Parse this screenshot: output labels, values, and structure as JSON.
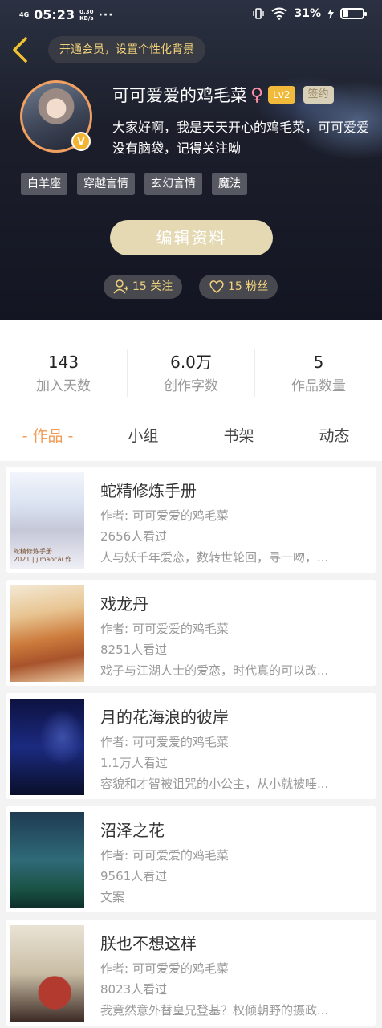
{
  "status_bar": {
    "network": "4G",
    "time": "05:23",
    "speed_value": "0.30",
    "speed_unit": "KB/s",
    "more": "···",
    "battery_pct": "31%",
    "battery_level": 0.31
  },
  "header": {
    "vip_prompt": "开通会员，设置个性化背景",
    "username": "可可爱爱的鸡毛菜",
    "gender_symbol": "♀",
    "level": "Lv2",
    "sign_badge": "签约",
    "bio": "大家好啊，我是天天开心的鸡毛菜，可可爱爱没有脑袋，记得关注呦",
    "tags": [
      "白羊座",
      "穿越言情",
      "玄幻言情",
      "魔法"
    ],
    "edit_button": "编辑资料",
    "follow_count": "15 关注",
    "fans_count": "15 粉丝",
    "verified_mark": "V"
  },
  "stats": [
    {
      "value": "143",
      "label": "加入天数"
    },
    {
      "value": "6.0万",
      "label": "创作字数"
    },
    {
      "value": "5",
      "label": "作品数量"
    }
  ],
  "tabs": [
    "- 作品 -",
    "小组",
    "书架",
    "动态"
  ],
  "books": [
    {
      "title": "蛇精修炼手册",
      "author": "作者: 可可爱爱的鸡毛菜",
      "reads": "2656人看过",
      "desc": "人与妖千年爱恋，数转世轮回，寻一吻，..."
    },
    {
      "title": "戏龙丹",
      "author": "作者: 可可爱爱的鸡毛菜",
      "reads": "8251人看过",
      "desc": "戏子与江湖人士的爱恋，时代真的可以改..."
    },
    {
      "title": "月的花海浪的彼岸",
      "author": "作者: 可可爱爱的鸡毛菜",
      "reads": "1.1万人看过",
      "desc": "容貌和才智被诅咒的小公主，从小就被唾..."
    },
    {
      "title": "沼泽之花",
      "author": "作者: 可可爱爱的鸡毛菜",
      "reads": "9561人看过",
      "desc": "文案"
    },
    {
      "title": "朕也不想这样",
      "author": "作者: 可可爱爱的鸡毛菜",
      "reads": "8023人看过",
      "desc": "我竟然意外替皇兄登基？权倾朝野的摄政..."
    }
  ],
  "cover_texts": {
    "book0": "蛇精修炼手册",
    "book0_sub": "2021 | jimaocai 作"
  },
  "colors": {
    "accent": "#f39b55",
    "gold": "#f1d27a",
    "edit_button_bg": "#e5d9b4",
    "level_badge": "#f1ba3a"
  }
}
